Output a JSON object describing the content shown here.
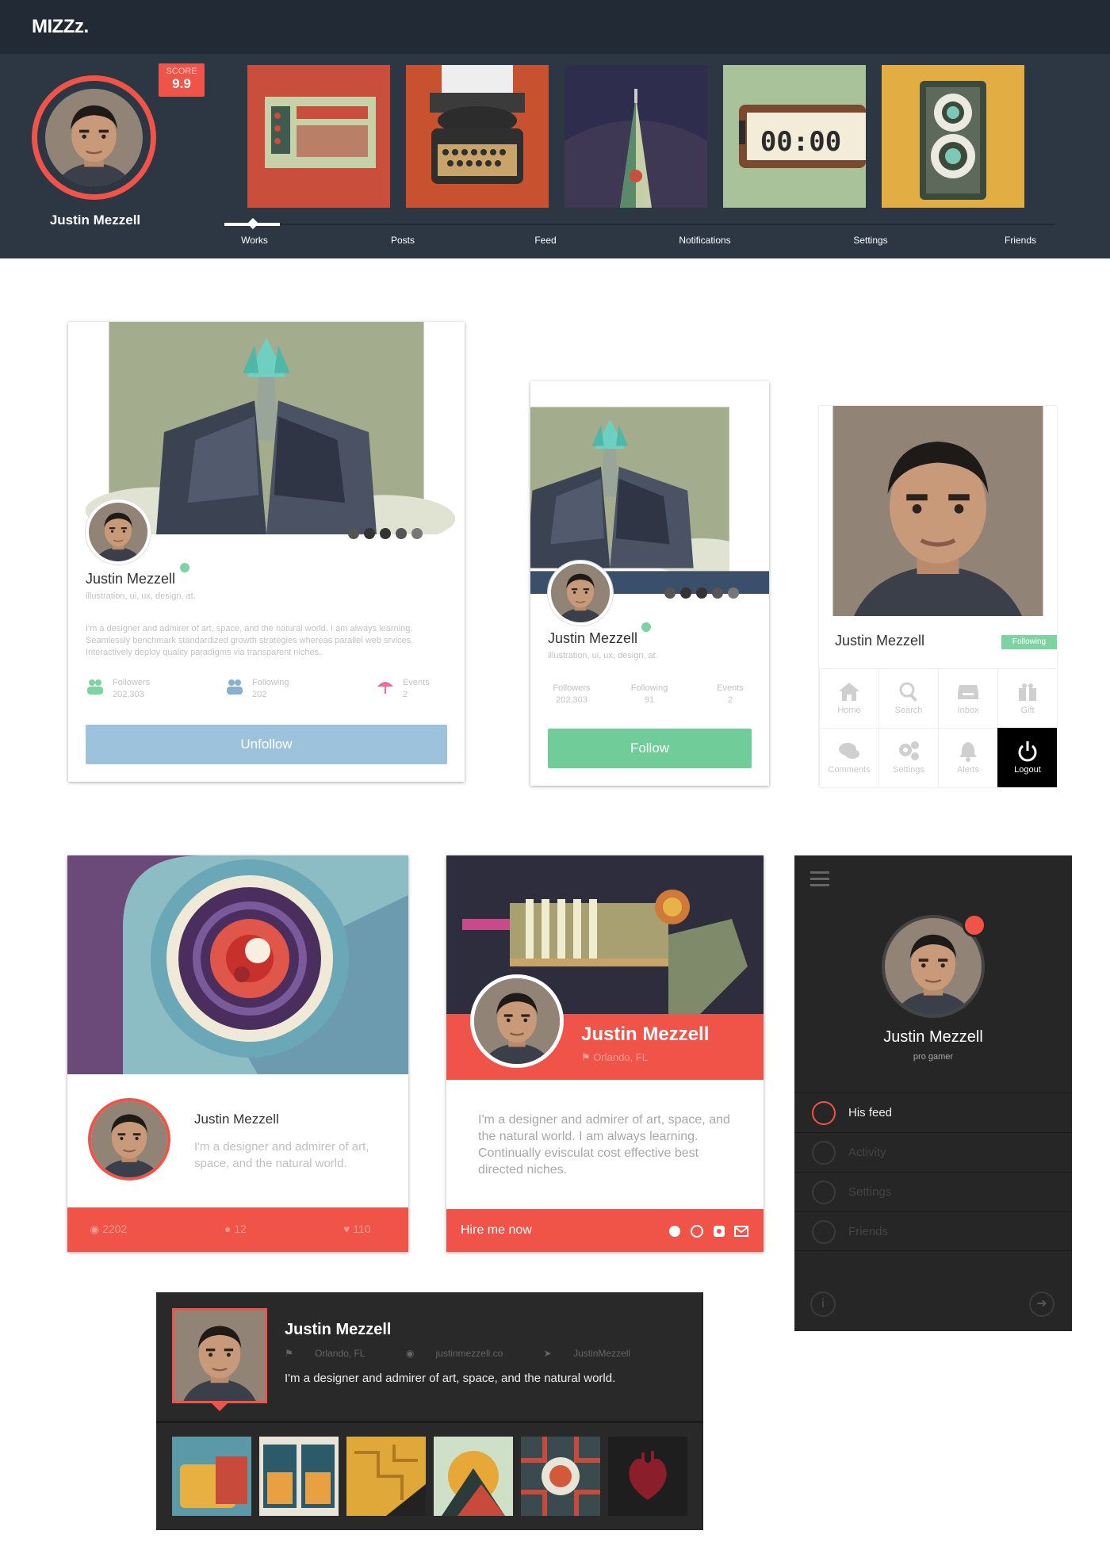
{
  "header": {
    "logo": "MIZZz.",
    "user_name": "Justin Mezzell",
    "score_label": "SCORE",
    "score_value": "9.9",
    "tabs": [
      "Works",
      "Posts",
      "Feed",
      "Notifications",
      "Settings",
      "Friends"
    ]
  },
  "card_profile_large": {
    "name": "Justin Mezzell",
    "tags": "illustration, ui, ux, design, at.",
    "bio": "I'm a designer and admirer of art, space, and the natural world. I am always learning. Seamlessly benchmark standardized growth strategies whereas parallel web srvices. Interactively deploy quality paradigms via transparent niches.",
    "stats": [
      {
        "label": "Followers",
        "value": "202,303"
      },
      {
        "label": "Following",
        "value": "202"
      },
      {
        "label": "Events",
        "value": "2"
      }
    ],
    "button": "Unfollow"
  },
  "card_profile_small": {
    "name": "Justin Mezzell",
    "tags": "illustration, ui, ux, design, at.",
    "stats": [
      {
        "label": "Followers",
        "value": "202,303"
      },
      {
        "label": "Following",
        "value": "91"
      },
      {
        "label": "Events",
        "value": "2"
      }
    ],
    "button": "Follow"
  },
  "card_menu": {
    "name": "Justin Mezzell",
    "badge": "Following",
    "items": [
      "Home",
      "Search",
      "Inbox",
      "Gift",
      "Comments",
      "Settings",
      "Alerts",
      "Logout"
    ]
  },
  "card_lens": {
    "name": "Justin Mezzell",
    "bio": "I'm a designer and admirer of art, space, and the natural world.",
    "views": "2202",
    "comments": "12",
    "likes": "110"
  },
  "card_hire": {
    "name": "Justin Mezzell",
    "location": "Orlando, FL",
    "bio": "I'm a designer and admirer of art, space, and the natural world. I am always learning. Continually evisculat cost effective best directed niches.",
    "cta": "Hire me now"
  },
  "dark_menu": {
    "name": "Justin Mezzell",
    "role": "pro gamer",
    "items": [
      "His feed",
      "Activity",
      "Settings",
      "Friends"
    ]
  },
  "bottom_profile": {
    "name": "Justin Mezzell",
    "location": "Orlando, FL",
    "website": "justinmezzell.co",
    "twitter": "JustinMezzell",
    "bio": "I'm a designer and admirer of art, space, and the natural world."
  },
  "colors": {
    "accent": "#f05348",
    "header_bg": "#2d3643",
    "topbar_bg": "#222a35",
    "follow_green": "#70cc98",
    "unfollow_blue": "#9cc3db",
    "dark_card": "#262626"
  }
}
